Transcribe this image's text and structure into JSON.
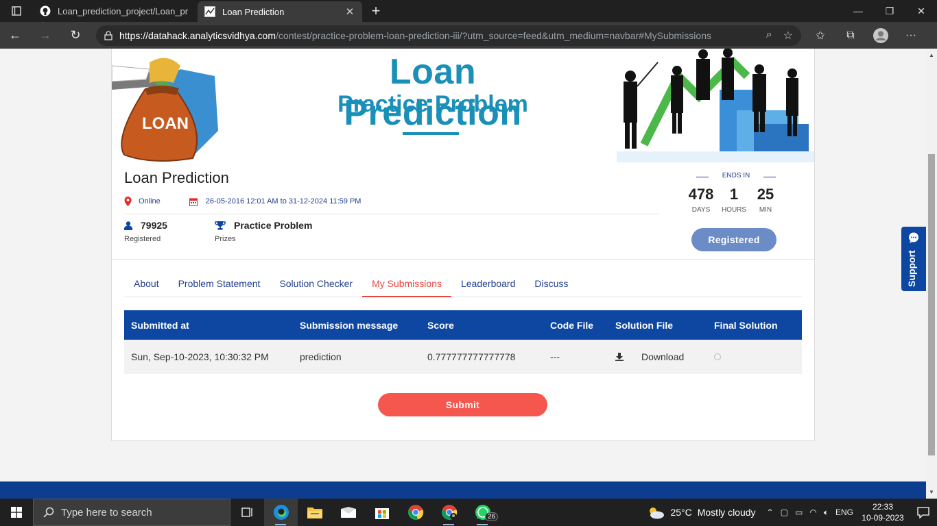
{
  "browser": {
    "tabs": [
      {
        "title": "Loan_prediction_project/Loan_pr",
        "icon": "github-icon",
        "active": false
      },
      {
        "title": "Loan Prediction",
        "icon": "analytics-vidhya-icon",
        "active": true
      }
    ],
    "url_scheme_host": "https://datahack.analyticsvidhya.com",
    "url_path": "/contest/practice-problem-loan-prediction-iii/?utm_source=feed&utm_medium=navbar#MySubmissions"
  },
  "banner": {
    "title": "Loan Prediction",
    "subtitle": "Practice Problem",
    "bag_label": "LOAN"
  },
  "contest": {
    "name": "Loan Prediction",
    "location": "Online",
    "dates": "26-05-2016 12:01 AM to 31-12-2024 11:59 PM",
    "registered_count": "79925",
    "registered_label": "Registered",
    "prize": "Practice Problem",
    "prize_label": "Prizes",
    "ends_in_label": "ENDS IN",
    "days": "478",
    "days_label": "DAYS",
    "hours": "1",
    "hours_label": "HOURS",
    "min": "25",
    "min_label": "MIN",
    "registered_button": "Registered"
  },
  "tabs": [
    "About",
    "Problem Statement",
    "Solution Checker",
    "My Submissions",
    "Leaderboard",
    "Discuss"
  ],
  "active_tab": "My Submissions",
  "table": {
    "headers": [
      "Submitted at",
      "Submission message",
      "Score",
      "Code File",
      "Solution File",
      "Final Solution"
    ],
    "rows": [
      {
        "submitted_at": "Sun, Sep-10-2023, 10:30:32 PM",
        "message": "prediction",
        "score": "0.777777777777778",
        "code_file": "---",
        "solution_file": "Download"
      }
    ]
  },
  "submit_button": "Submit",
  "support_label": "Support",
  "taskbar": {
    "search_placeholder": "Type here to search",
    "weather_temp": "25°C",
    "weather_text": "Mostly cloudy",
    "language": "ENG",
    "time": "22:33",
    "date": "10-09-2023",
    "whatsapp_badge": "26"
  },
  "colors": {
    "brand_blue": "#0d47a1",
    "accent_red": "#f5564e",
    "registered_button": "#6b8cc7",
    "banner_text": "#1a8fb8"
  }
}
